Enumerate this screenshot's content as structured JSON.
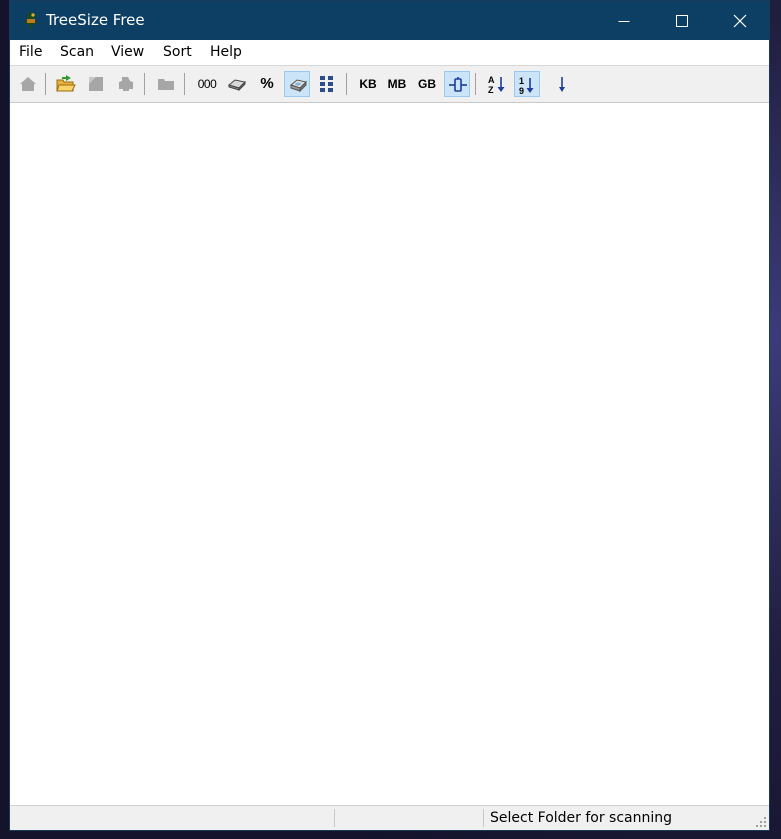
{
  "window": {
    "title": "TreeSize Free"
  },
  "menu": [
    "File",
    "Scan",
    "View",
    "Sort",
    "Help"
  ],
  "toolbar": {
    "thousands_label": "000",
    "percent_label": "%",
    "kb_label": "KB",
    "mb_label": "MB",
    "gb_label": "GB"
  },
  "status": {
    "message": "Select Folder for scanning"
  },
  "colors": {
    "titlebar": "#0c3f63",
    "toolbar_bg": "#f0f0f0",
    "pressed_bg": "#cce4f7",
    "pressed_border": "#99c9ef",
    "accent_blue": "#1c3d9c"
  }
}
